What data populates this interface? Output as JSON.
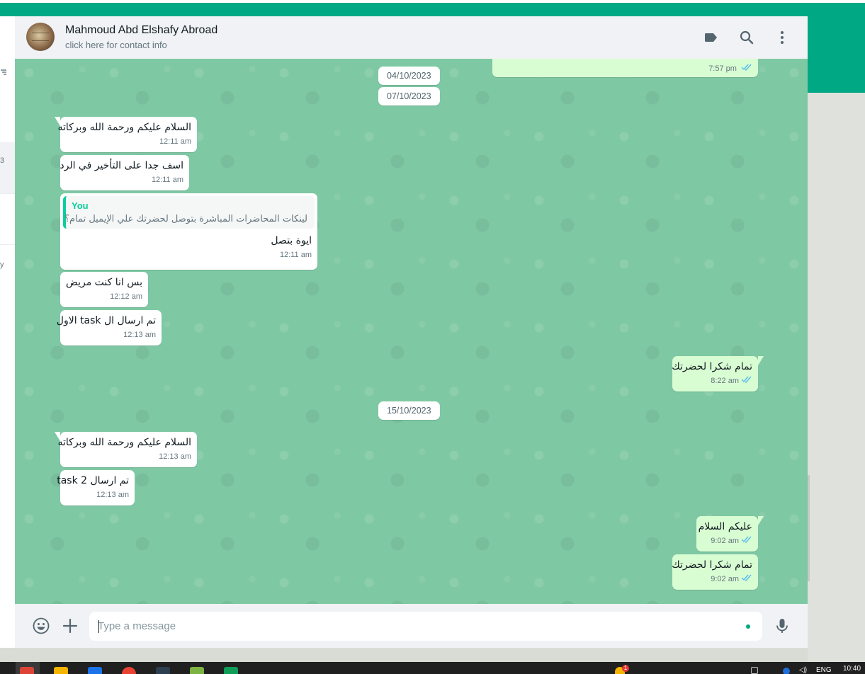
{
  "header": {
    "contact_name": "Mahmoud Abd Elshafy Abroad",
    "contact_sub": "click here for contact info"
  },
  "sidebar": {
    "partial_count": "3",
    "partial_text": "y"
  },
  "chat": {
    "top_partial_time": "7:57 pm",
    "dates": [
      "04/10/2023",
      "07/10/2023",
      "15/10/2023"
    ],
    "messages": [
      {
        "dir": "in",
        "text": "السلام عليكم ورحمة الله وبركاته",
        "time": "12:11 am"
      },
      {
        "dir": "in",
        "text": "اسف جدا على التأخير في الرد",
        "time": "12:11 am"
      },
      {
        "dir": "in",
        "quote_author": "You",
        "quote_text": "لينكات المحاضرات المباشرة بتوصل لحضرتك علي الإيميل تمام؟",
        "text": "ايوة بتصل",
        "time": "12:11 am"
      },
      {
        "dir": "in",
        "text": "بس انا كنت مريض",
        "time": "12:12 am"
      },
      {
        "dir": "in",
        "text": "تم ارسال ال task الاول",
        "time": "12:13 am"
      },
      {
        "dir": "out",
        "text": "تمام شكرا لحضرتك",
        "time": "8:22 am"
      },
      {
        "dir": "in",
        "text": "السلام عليكم ورحمة الله وبركاته",
        "time": "12:13 am"
      },
      {
        "dir": "in",
        "text": "تم ارسال task 2",
        "time": "12:13 am"
      },
      {
        "dir": "out",
        "text": "عليكم السلام",
        "time": "9:02 am"
      },
      {
        "dir": "out",
        "text": "تمام شكرا لحضرتك",
        "time": "9:02 am"
      }
    ]
  },
  "composer": {
    "placeholder": "Type a message"
  },
  "taskbar": {
    "tray_badge": "1",
    "tray_lang": "ENG",
    "clock": "10:40"
  },
  "colors": {
    "brand_green": "#00a884",
    "chat_bg": "#7fc8a4",
    "incoming_bubble": "#ffffff",
    "outgoing_bubble": "#d9fdd3",
    "read_ticks": "#53bdeb"
  },
  "icons": {
    "header": [
      "label-icon",
      "search-icon",
      "menu-icon"
    ],
    "composer": [
      "emoji-icon",
      "attach-icon",
      "mic-icon"
    ]
  }
}
